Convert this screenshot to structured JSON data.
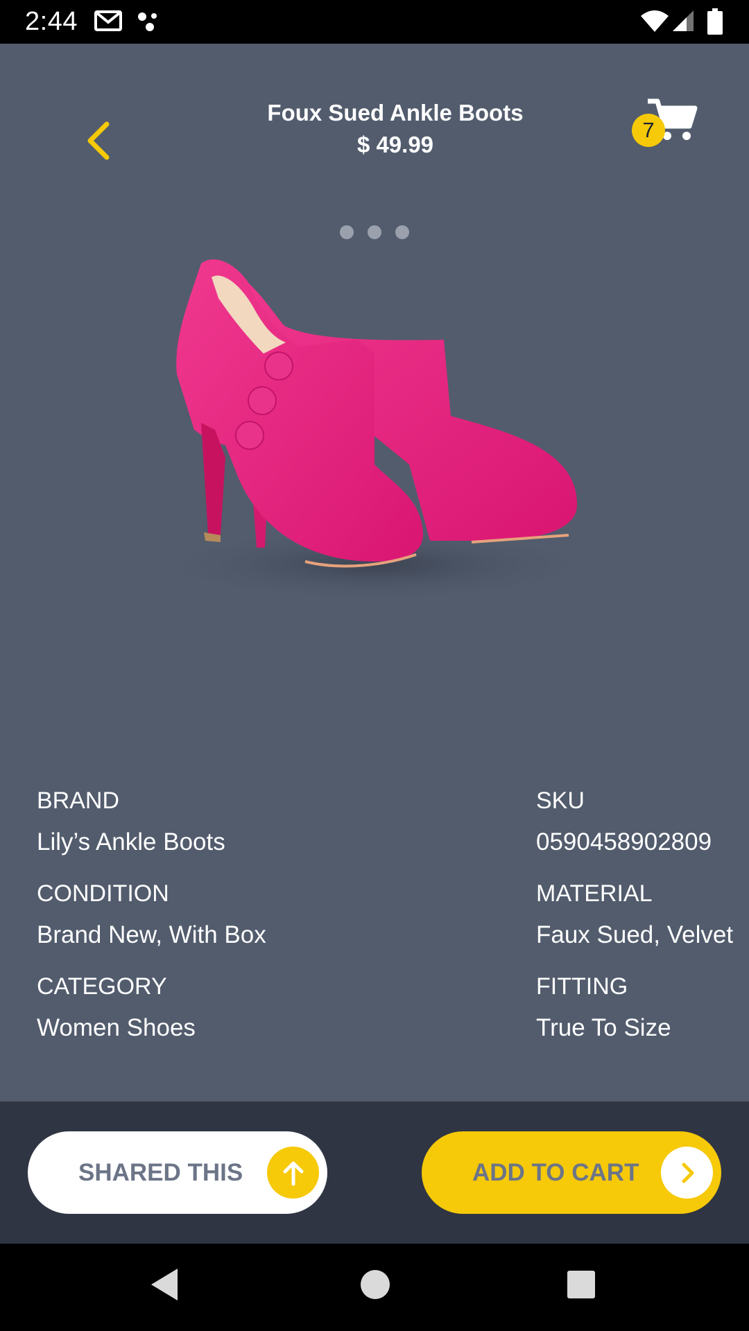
{
  "status_bar": {
    "time": "2:44",
    "icons": [
      "gmail-icon",
      "dots-icon",
      "wifi-icon",
      "signal-icon",
      "battery-icon"
    ]
  },
  "header": {
    "title": "Foux Sued Ankle Boots",
    "price": "$ 49.99",
    "cart_count": "7",
    "icons": [
      "back-chevron-icon",
      "cart-icon"
    ]
  },
  "gallery": {
    "pages": 3
  },
  "details": {
    "left": [
      {
        "label": "BRAND",
        "value": "Lily’s Ankle Boots"
      },
      {
        "label": "CONDITION",
        "value": "Brand New, With Box"
      },
      {
        "label": "CATEGORY",
        "value": "Women Shoes"
      }
    ],
    "right": [
      {
        "label": "SKU",
        "value": "0590458902809"
      },
      {
        "label": "MATERIAL",
        "value": "Faux Sued, Velvet"
      },
      {
        "label": "FITTING",
        "value": "True To Size"
      }
    ]
  },
  "actions": {
    "share_label": "SHARED THIS",
    "add_to_cart_label": "ADD TO CART",
    "icons": [
      "arrow-up-icon",
      "chevron-right-icon"
    ]
  },
  "colors": {
    "accent": "#f6c909",
    "background": "#525c6d",
    "action_bar": "#2f3543",
    "button_text": "#6c7587"
  }
}
